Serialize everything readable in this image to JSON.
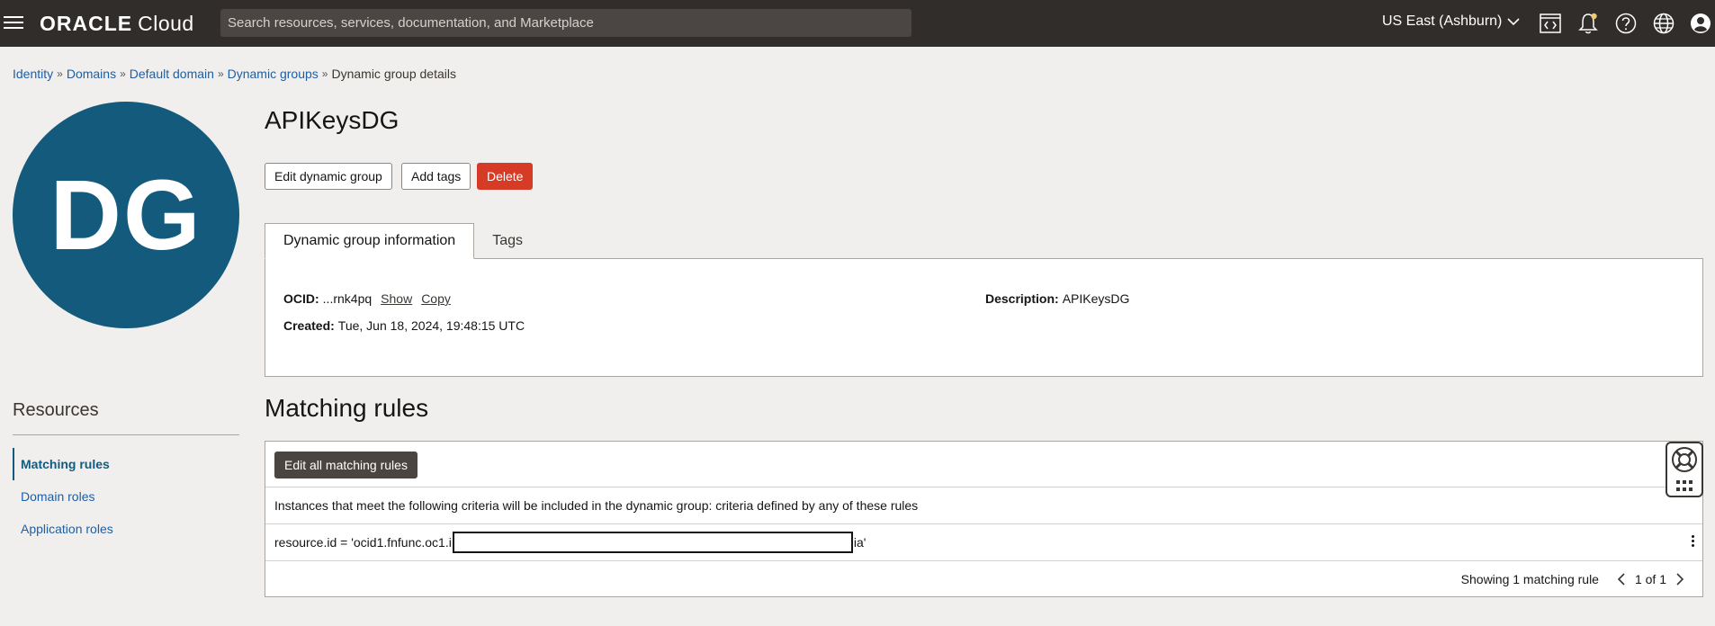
{
  "header": {
    "logo_brand": "ORACLE",
    "logo_product": "Cloud",
    "search_placeholder": "Search resources, services, documentation, and Marketplace",
    "region": "US East (Ashburn)"
  },
  "breadcrumb": [
    {
      "label": "Identity"
    },
    {
      "label": "Domains"
    },
    {
      "label": "Default domain"
    },
    {
      "label": "Dynamic groups"
    },
    {
      "label": "Dynamic group details"
    }
  ],
  "avatar": {
    "initials": "DG",
    "color": "#145a7d"
  },
  "page_title": "APIKeysDG",
  "actions": {
    "edit": "Edit dynamic group",
    "add_tags": "Add tags",
    "delete": "Delete"
  },
  "tabs": [
    {
      "label": "Dynamic group information",
      "active": true
    },
    {
      "label": "Tags",
      "active": false
    }
  ],
  "info": {
    "ocid_label": "OCID:",
    "ocid_value": "...rnk4pq",
    "show_link": "Show",
    "copy_link": "Copy",
    "created_label": "Created:",
    "created_value": "Tue, Jun 18, 2024, 19:48:15 UTC",
    "description_label": "Description:",
    "description_value": "APIKeysDG"
  },
  "resources": {
    "title": "Resources",
    "items": [
      {
        "label": "Matching rules",
        "active": true
      },
      {
        "label": "Domain roles",
        "active": false
      },
      {
        "label": "Application roles",
        "active": false
      }
    ]
  },
  "matching_rules": {
    "title": "Matching rules",
    "edit_button": "Edit all matching rules",
    "description": "Instances that meet the following criteria will be included in the dynamic group: criteria defined by any of these rules",
    "rule_prefix": "resource.id = 'ocid1.fnfunc.oc1.i",
    "rule_suffix": "ia'",
    "showing": "Showing 1 matching rule",
    "page": "1 of 1"
  },
  "colors": {
    "topbar": "#312d2a",
    "link": "#1e5fa3",
    "danger": "#d63b25"
  }
}
